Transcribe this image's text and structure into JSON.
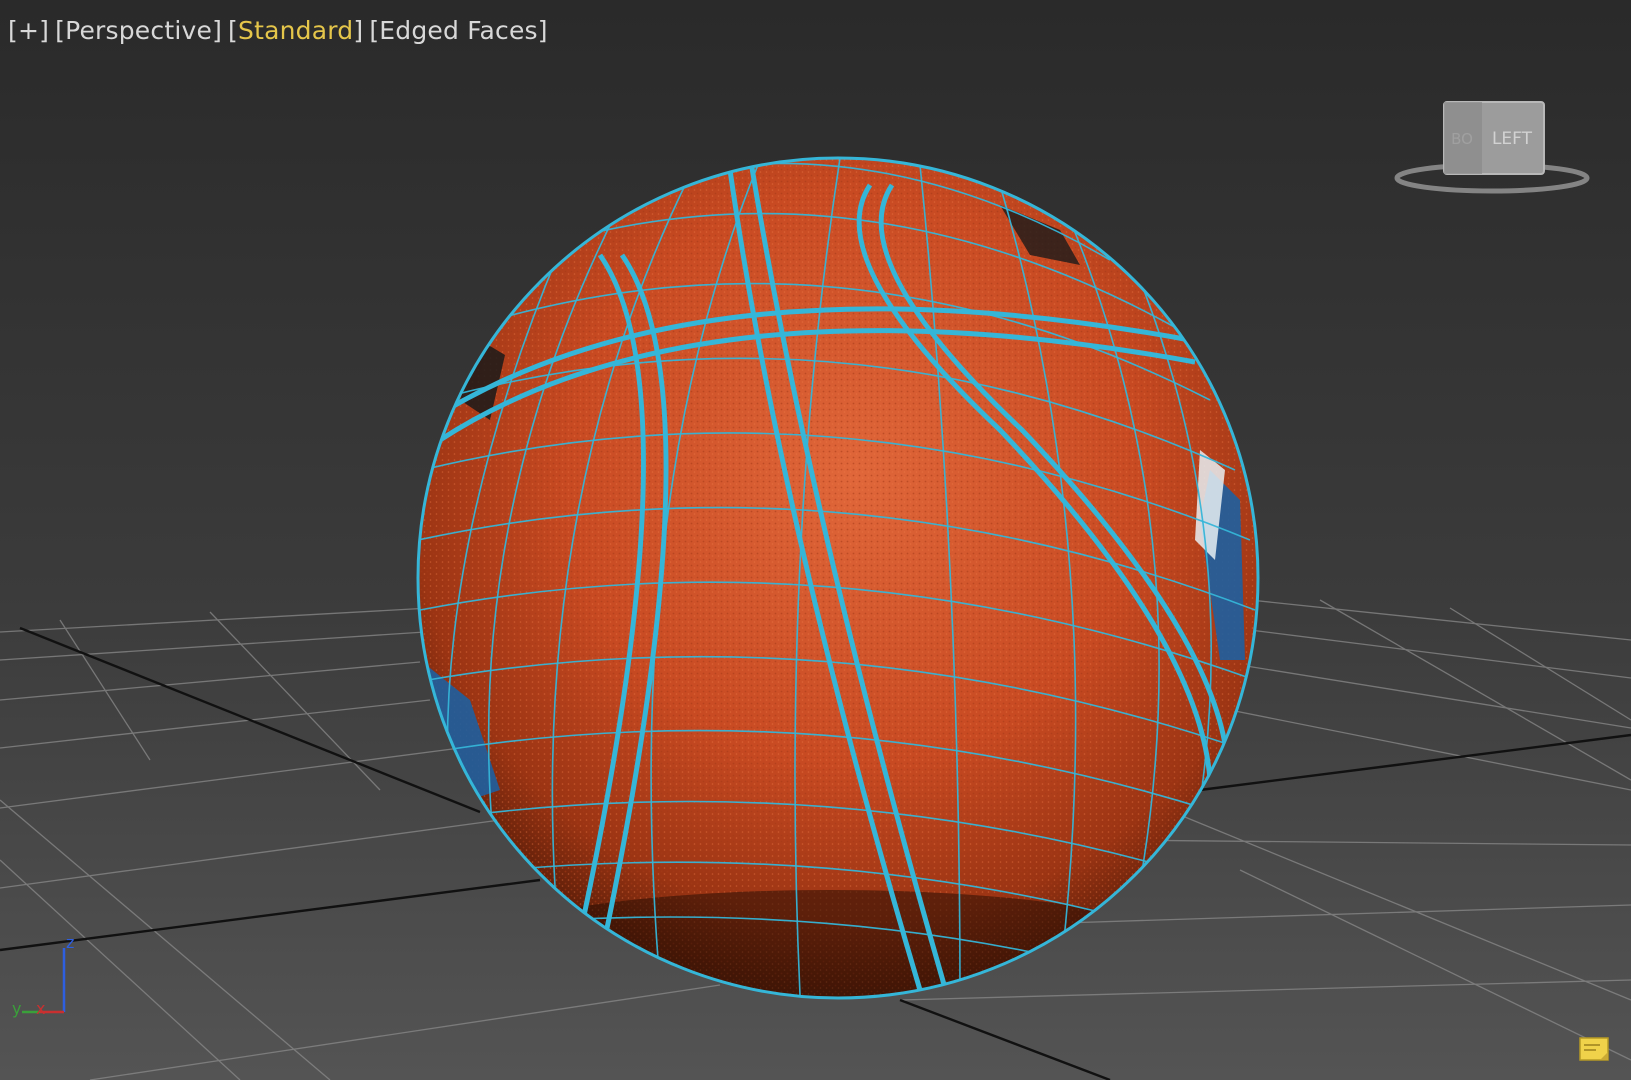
{
  "viewport": {
    "labels": {
      "plus": "+",
      "view": "Perspective",
      "shading": "Standard",
      "display": "Edged Faces"
    }
  },
  "viewcube": {
    "face_label": "LEFT",
    "faint_face_label": "BO"
  },
  "axis_tripod": {
    "z": "z",
    "y": "y",
    "x": "x"
  },
  "colors": {
    "wire": "#35b6d8",
    "ball": "#c84a22",
    "label_active": "#e5c64a",
    "label_text": "#d8d8d8"
  },
  "icons": {
    "viewcube": "viewcube-icon",
    "axis": "axis-tripod-icon",
    "corner": "sticky-note-icon"
  }
}
